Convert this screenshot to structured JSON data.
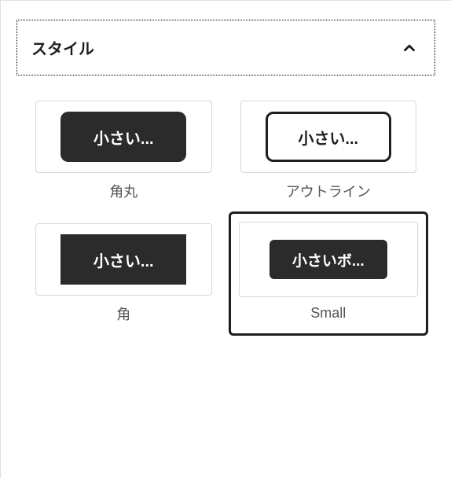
{
  "panel": {
    "title": "スタイル",
    "expanded": true
  },
  "styles": [
    {
      "preview_text": "小さい...",
      "label": "角丸",
      "variant": "rounded",
      "selected": false
    },
    {
      "preview_text": "小さい...",
      "label": "アウトライン",
      "variant": "outline",
      "selected": false
    },
    {
      "preview_text": "小さい...",
      "label": "角",
      "variant": "square",
      "selected": false
    },
    {
      "preview_text": "小さいボ...",
      "label": "Small",
      "variant": "small",
      "selected": true
    }
  ]
}
